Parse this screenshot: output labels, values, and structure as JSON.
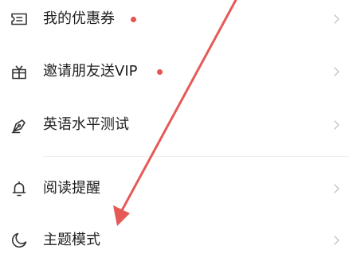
{
  "colors": {
    "badge": "#e9544e",
    "chevron": "#c4c4c4",
    "icon": "#333333",
    "annotation_arrow": "#e55a57"
  },
  "menu": {
    "items": [
      {
        "label": "我的优惠券",
        "icon": "coupon-icon",
        "badge": true
      },
      {
        "label": "邀请朋友送VIP",
        "icon": "gift-icon",
        "badge": true
      },
      {
        "label": "英语水平测试",
        "icon": "pen-nib-icon",
        "badge": false
      },
      {
        "label": "阅读提醒",
        "icon": "bell-icon",
        "badge": false
      },
      {
        "label": "主题模式",
        "icon": "moon-icon",
        "badge": false
      }
    ]
  }
}
